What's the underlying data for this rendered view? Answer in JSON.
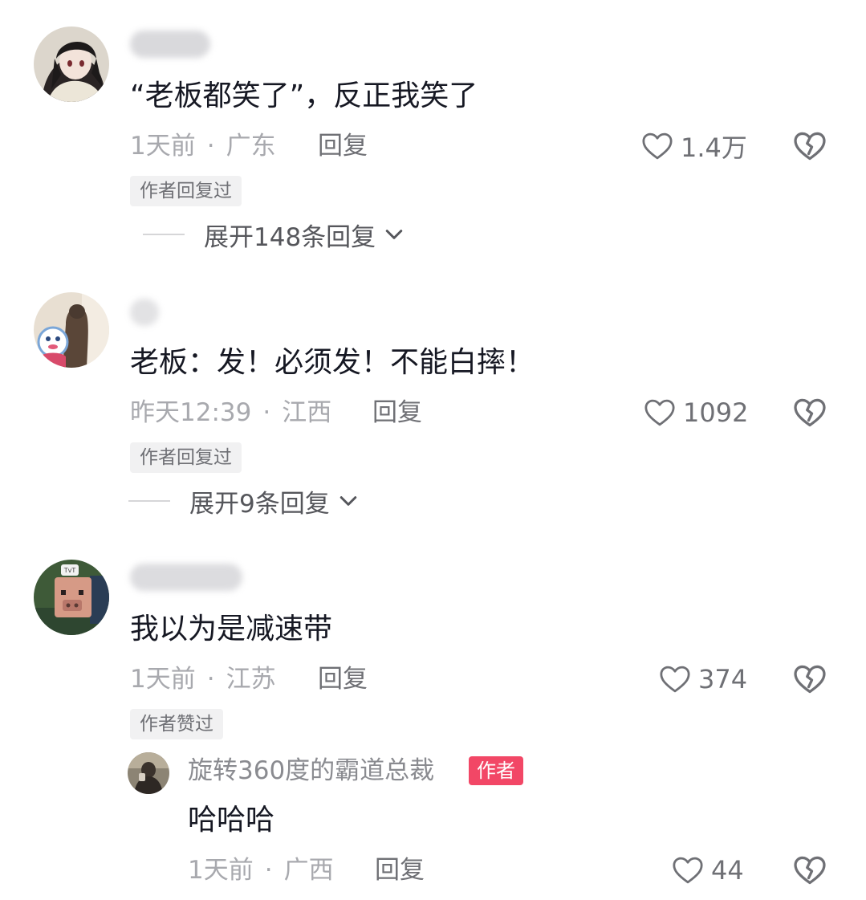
{
  "accent": {
    "author_tag_bg": "#f24766",
    "muted_text": "#a8a9ae",
    "text": "#161823"
  },
  "comments": [
    {
      "avatar_icon": "anime-girl-avatar",
      "text": "“老板都笑了”，反正我笑了",
      "time": "1天前",
      "location": "广东",
      "reply_label": "回复",
      "likes": "1.4万",
      "badge": "作者回复过",
      "expand_label": "展开148条回复"
    },
    {
      "avatar_icon": "cartoon-avatar",
      "text": "老板：发！必须发！不能白摔！",
      "time": "昨天12:39",
      "location": "江西",
      "reply_label": "回复",
      "likes": "1092",
      "badge": "作者回复过",
      "expand_label": "展开9条回复"
    },
    {
      "avatar_icon": "pig-avatar",
      "text": "我以为是减速带",
      "time": "1天前",
      "location": "江苏",
      "reply_label": "回复",
      "likes": "374",
      "badge": "作者赞过",
      "reply": {
        "avatar_icon": "person-avatar",
        "username": "旋转360度的霸道总裁",
        "author_tag": "作者",
        "text": "哈哈哈",
        "time": "1天前",
        "location": "广西",
        "reply_label": "回复",
        "likes": "44"
      }
    }
  ],
  "separator": "·"
}
